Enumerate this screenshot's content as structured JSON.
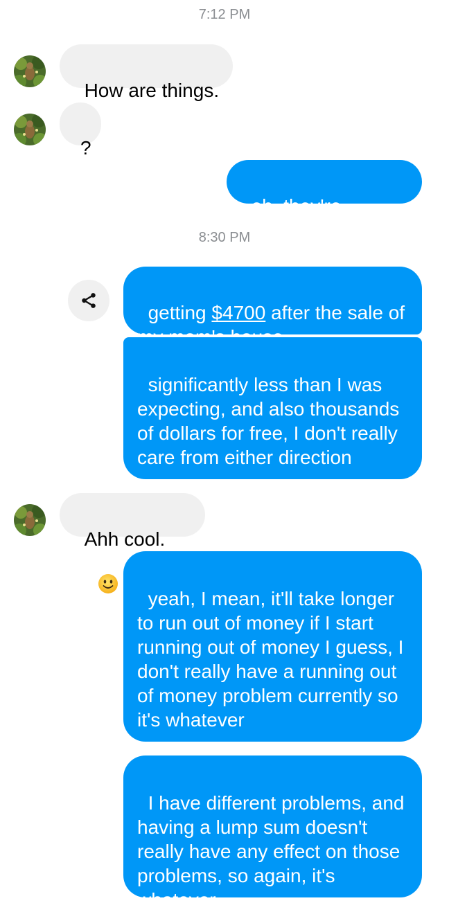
{
  "conversation": {
    "timestamps": [
      "7:12 PM",
      "8:30 PM"
    ],
    "messages": [
      {
        "sender": "them",
        "text": "How are things."
      },
      {
        "sender": "them",
        "text": "?"
      },
      {
        "sender": "me",
        "text": "eh, they're, y'know"
      },
      {
        "sender": "me",
        "text_before": "getting ",
        "link_text": "$4700",
        "text_after": " after the sale of my mom's house"
      },
      {
        "sender": "me",
        "text": "significantly less than I was expecting, and also thousands of dollars for free, I don't really care from either direction"
      },
      {
        "sender": "them",
        "text": "Ahh cool.",
        "emoji": "slightly-smiling-face"
      },
      {
        "sender": "me",
        "text": "yeah, I mean, it'll take longer to run out of money if I start running out of money I guess, I don't really have a running out of money problem currently so it's whatever"
      },
      {
        "sender": "me",
        "text": "I have different problems, and having a lump sum doesn't really have any effect on those problems, so again, it's whatever"
      }
    ]
  },
  "icons": {
    "avatar": "contact-avatar",
    "share": "share-icon",
    "emoji": "slightly-smiling-face-icon"
  },
  "colors": {
    "outgoing_bubble": "#0097f7",
    "incoming_bubble": "#f0f0f0",
    "timestamp_text": "#8a8d91"
  }
}
